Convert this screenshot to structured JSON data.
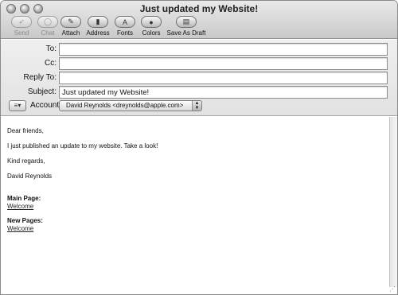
{
  "window": {
    "title": "Just updated my Website!"
  },
  "toolbar": {
    "send": "Send",
    "chat": "Chat",
    "attach": "Attach",
    "address": "Address",
    "fonts": "Fonts",
    "colors": "Colors",
    "save_draft": "Save As Draft"
  },
  "fields": {
    "to_label": "To:",
    "to_value": "",
    "cc_label": "Cc:",
    "cc_value": "",
    "replyto_label": "Reply To:",
    "replyto_value": "",
    "subject_label": "Subject:",
    "subject_value": "Just updated my Website!",
    "account_label": "Account:",
    "account_value": "David Reynolds <dreynolds@apple.com>"
  },
  "message": {
    "greeting": "Dear friends,",
    "line1": "I just published an update to my website. Take a look!",
    "closing": "Kind regards,",
    "signature": "David Reynolds",
    "main_heading": "Main Page:",
    "main_link": "Welcome",
    "new_heading": "New Pages:",
    "new_link": "Welcome"
  }
}
